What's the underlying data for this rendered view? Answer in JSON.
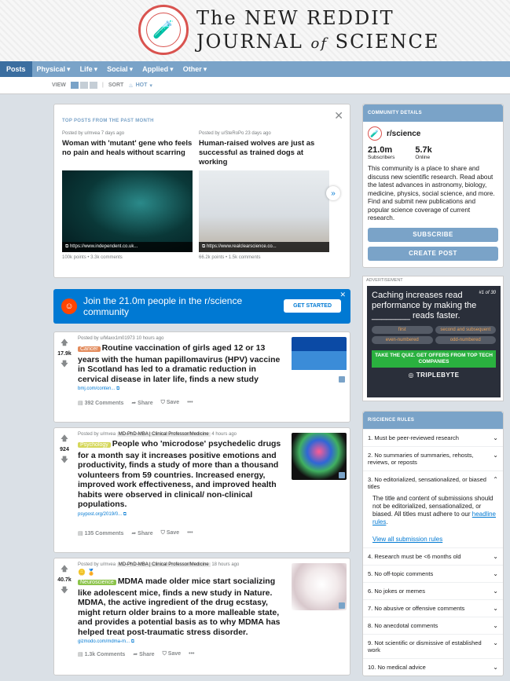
{
  "banner": {
    "title_line1": "The NEW REDDIT",
    "title_line2_a": "JOURNAL",
    "title_line2_of": "of",
    "title_line2_b": "SCIENCE"
  },
  "nav": {
    "items": [
      {
        "label": "Posts"
      },
      {
        "label": "Physical"
      },
      {
        "label": "Life"
      },
      {
        "label": "Social"
      },
      {
        "label": "Applied"
      },
      {
        "label": "Other"
      }
    ]
  },
  "toolbar": {
    "view_label": "VIEW",
    "sort_label": "SORT",
    "sort_value": "HOT"
  },
  "top_posts": {
    "heading": "TOP POSTS FROM THE PAST MONTH",
    "items": [
      {
        "meta": "Posted by u/mvea 7 days ago",
        "title": "Woman with 'mutant' gene who feels no pain and heals without scarring",
        "link": "https://www.independent.co.uk...",
        "stats": "100k points • 3.3k comments"
      },
      {
        "meta": "Posted by u/SteRoPo 23 days ago",
        "title": "Human-raised wolves are just as successful as trained dogs at working",
        "link": "https://www.realclearscience.co...",
        "stats": "66.2k points • 1.5k comments"
      }
    ]
  },
  "join": {
    "text": "Join the 21.0m people in the r/science community",
    "button": "GET STARTED"
  },
  "posts": [
    {
      "votes": "17.9k",
      "meta": "Posted by u/Maxx1m01973 10 hours ago",
      "user_flair": "",
      "tag": "Cancer",
      "tag_color": "#e38b5c",
      "title": "Routine vaccination of girls aged 12 or 13 years with the human papillomavirus (HPV) vaccine in Scotland has led to a dramatic reduction in cervical disease in later life, finds a new study",
      "link": "bmj.com/conten...",
      "comments": "392 Comments",
      "share": "Share",
      "save": "Save"
    },
    {
      "votes": "924",
      "meta": "Posted by u/mvea",
      "user_flair": "MD-PhD-MBA | Clinical Professor/Medicine",
      "time": "4 hours ago",
      "tag": "Psychology",
      "tag_color": "#d5d75a",
      "title": "People who 'microdose' psychedelic drugs for a month say it increases positive emotions and productivity, finds a study of more than a thousand volunteers from 59 countries. Increased energy, improved work effectiveness, and improved health habits were observed in clinical/ non-clinical populations.",
      "link": "psypost.org/2019/0...",
      "comments": "135 Comments",
      "share": "Share",
      "save": "Save"
    },
    {
      "votes": "40.7k",
      "meta": "Posted by u/mvea",
      "user_flair": "MD-PhD-MBA | Clinical Professor/Medicine",
      "time": "18 hours ago",
      "tag": "Neuroscience",
      "tag_color": "#8bc34a",
      "title": "MDMA made older mice start socializing like adolescent mice, finds a new study in Nature. MDMA, the active ingredient of the drug ecstasy, might return older brains to a more malleable state, and provides a potential basis as to why MDMA has helped treat post-traumatic stress disorder.",
      "link": "gizmodo.com/mdma-m...",
      "comments": "1.3k Comments",
      "share": "Share",
      "save": "Save"
    }
  ],
  "community": {
    "heading": "COMMUNITY DETAILS",
    "name": "r/science",
    "subscribers": "21.0m",
    "subscribers_label": "Subscribers",
    "online": "5.7k",
    "online_label": "Online",
    "description": "This community is a place to share and discuss new scientific research. Read about the latest advances in astronomy, biology, medicine, physics, social science, and more. Find and submit new publications and popular science coverage of current research.",
    "subscribe": "SUBSCRIBE",
    "create_post": "CREATE POST"
  },
  "ad": {
    "label": "ADVERTISEMENT",
    "counter": "#1 of 30",
    "question": "Caching increases read performance by making the ________ reads faster.",
    "options": [
      "first",
      "second and subsequent",
      "even-numbered",
      "odd-numbered"
    ],
    "cta": "TAKE THE QUIZ. GET OFFERS FROM TOP TECH COMPANIES",
    "brand": "TRIPLEBYTE"
  },
  "rules": {
    "heading": "R/SCIENCE RULES",
    "items": [
      "1. Must be peer-reviewed research",
      "2. No summaries of summaries, rehosts, reviews, or reposts",
      "3. No editorialized, sensationalized, or biased titles",
      "4. Research must be <6 months old",
      "5. No off-topic comments",
      "6. No jokes or memes",
      "7. No abusive or offensive comments",
      "8. No anecdotal comments",
      "9. Not scientific or dismissive of established work",
      "10. No medical advice"
    ],
    "expanded_text": "The title and content of submissions should not be editorialized, sensationalized, or biased. All titles must adhere to our",
    "expanded_link": "headline rules",
    "view_all": "View all submission rules"
  }
}
